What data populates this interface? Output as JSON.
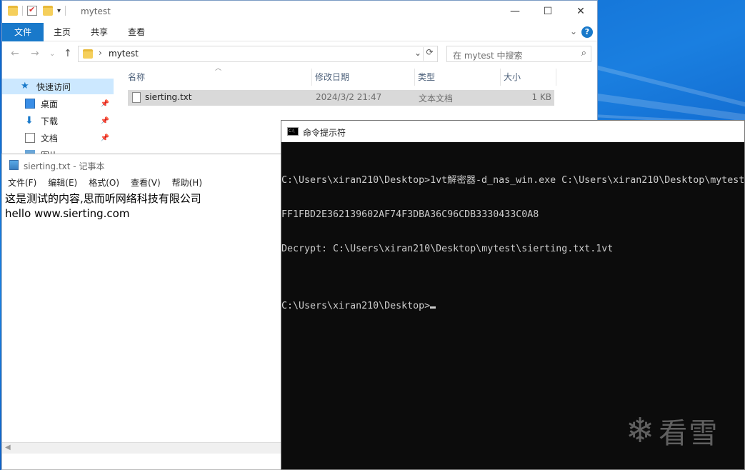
{
  "explorer": {
    "title": "mytest",
    "ribbon_tabs": [
      "文件",
      "主页",
      "共享",
      "查看"
    ],
    "address": "mytest",
    "search_placeholder": "在 mytest 中搜索",
    "nav_items": [
      {
        "label": "快速访问",
        "icon": "star-icon"
      },
      {
        "label": "桌面",
        "icon": "desktop-icon"
      },
      {
        "label": "下载",
        "icon": "download-icon"
      },
      {
        "label": "文档",
        "icon": "document-icon"
      },
      {
        "label": "图片",
        "icon": "picture-icon"
      }
    ],
    "columns": [
      "名称",
      "修改日期",
      "类型",
      "大小"
    ],
    "files": [
      {
        "name": "sierting.txt",
        "modified": "2024/3/2 21:47",
        "type": "文本文档",
        "size": "1 KB"
      }
    ]
  },
  "notepad": {
    "title": "sierting.txt - 记事本",
    "menu": [
      "文件(F)",
      "编辑(E)",
      "格式(O)",
      "查看(V)",
      "帮助(H)"
    ],
    "lines": [
      "这是测试的内容,思而听网络科技有限公司",
      "hello www.sierting.com"
    ]
  },
  "cmd": {
    "title": "命令提示符",
    "lines": [
      "C:\\Users\\xiran210\\Desktop>1vt解密器-d_nas_win.exe C:\\Users\\xiran210\\Desktop\\mytest",
      "FF1FBD2E362139602AF74F3DBA36C96CDB3330433C0A8",
      "Decrypt: C:\\Users\\xiran210\\Desktop\\mytest\\sierting.txt.1vt",
      "",
      "C:\\Users\\xiran210\\Desktop>"
    ]
  },
  "watermark": "看雪",
  "colors": {
    "accent": "#1979ca",
    "desktop": "#0b63c9",
    "console_bg": "#0c0c0c",
    "console_fg": "#cccccc"
  }
}
